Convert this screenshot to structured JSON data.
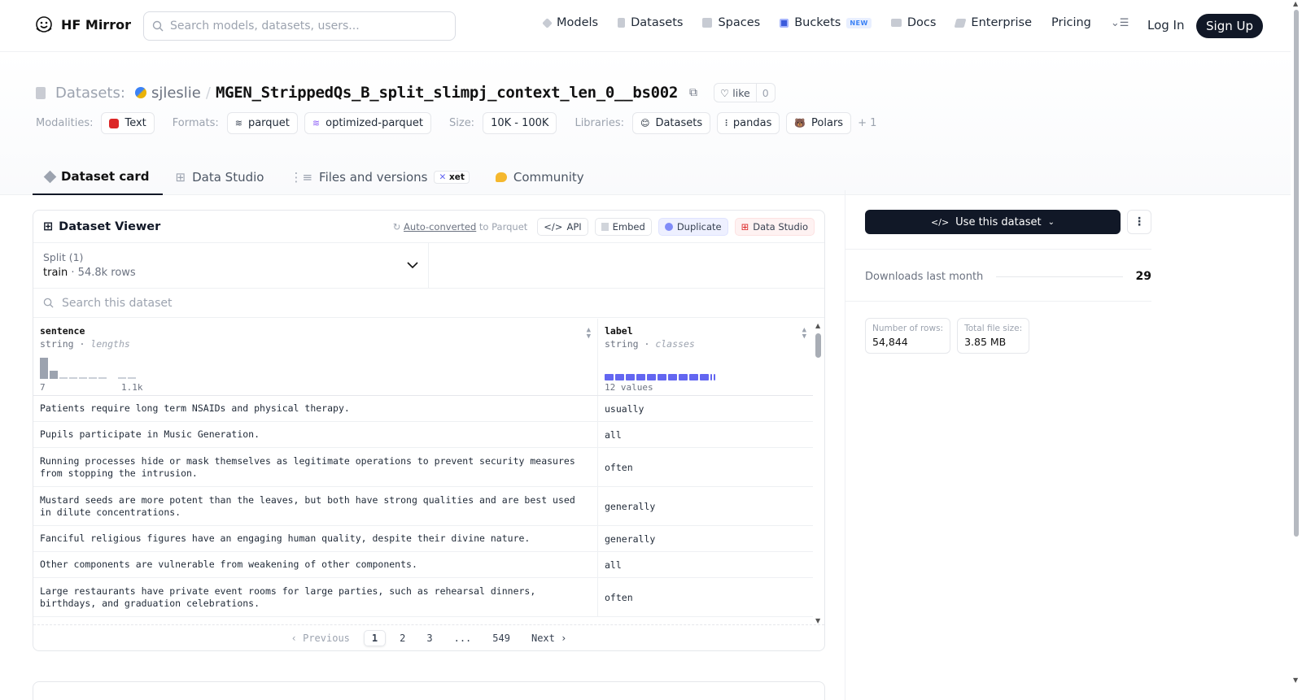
{
  "nav": {
    "brand": "HF Mirror",
    "search_placeholder": "Search models, datasets, users...",
    "links": [
      {
        "label": "Models",
        "icon": "models-icon"
      },
      {
        "label": "Datasets",
        "icon": "datasets-icon"
      },
      {
        "label": "Spaces",
        "icon": "spaces-icon"
      },
      {
        "label": "Buckets",
        "icon": "buckets-icon",
        "badge": "NEW"
      },
      {
        "label": "Docs",
        "icon": "docs-icon"
      },
      {
        "label": "Enterprise",
        "icon": "enterprise-icon"
      },
      {
        "label": "Pricing"
      }
    ],
    "login": "Log In",
    "signup": "Sign Up"
  },
  "header": {
    "section": "Datasets:",
    "owner": "sjleslie",
    "repo": "MGEN_StrippedQs_B_split_slimpj_context_len_0__bs002",
    "like_label": "like",
    "like_count": "0",
    "modalities_label": "Modalities:",
    "modality": "Text",
    "formats_label": "Formats:",
    "formats": [
      "parquet",
      "optimized-parquet"
    ],
    "size_label": "Size:",
    "size": "10K - 100K",
    "libraries_label": "Libraries:",
    "libraries": [
      "Datasets",
      "pandas",
      "Polars"
    ],
    "libraries_more": "+ 1"
  },
  "tabs": [
    {
      "label": "Dataset card",
      "active": true
    },
    {
      "label": "Data Studio"
    },
    {
      "label": "Files and versions",
      "badge": "xet"
    },
    {
      "label": "Community"
    }
  ],
  "viewer": {
    "title": "Dataset Viewer",
    "auto_converted": "Auto-converted",
    "auto_converted_suffix": "to Parquet",
    "actions": [
      "API",
      "Embed",
      "Duplicate",
      "Data Studio"
    ],
    "split_label": "Split (1)",
    "split_name": "train",
    "split_rows": "54.8k rows",
    "search_placeholder": "Search this dataset",
    "columns": [
      {
        "name": "sentence",
        "type": "string",
        "stat": "lengths",
        "min": "7",
        "max": "1.1k"
      },
      {
        "name": "label",
        "type": "string",
        "stat": "classes",
        "values": "12 values"
      }
    ],
    "rows": [
      {
        "sentence": "Patients require long term NSAIDs and physical therapy.",
        "label": "usually"
      },
      {
        "sentence": "Pupils participate in Music Generation.",
        "label": "all"
      },
      {
        "sentence": "Running processes hide or mask themselves as legitimate operations to prevent security measures from stopping the intrusion.",
        "label": "often"
      },
      {
        "sentence": "Mustard seeds are more potent than the leaves, but both have strong qualities and are best used in dilute concentrations.",
        "label": "generally"
      },
      {
        "sentence": "Fanciful religious figures have an engaging human quality, despite their divine nature.",
        "label": "generally"
      },
      {
        "sentence": "Other components are vulnerable from weakening of other components.",
        "label": "all"
      },
      {
        "sentence": "Large restaurants have private event rooms for large parties, such as rehearsal dinners, birthdays, and graduation celebrations.",
        "label": "often"
      }
    ],
    "pager": {
      "prev": "Previous",
      "pages": [
        "1",
        "2",
        "3",
        "...",
        "549"
      ],
      "next": "Next"
    }
  },
  "sidebar": {
    "use_button": "Use this dataset",
    "downloads_label": "Downloads last month",
    "downloads": "29",
    "rows_label": "Number of rows:",
    "rows_value": "54,844",
    "filesize_label": "Total file size:",
    "filesize_value": "3.85 MB"
  },
  "colors": {
    "accent": "#6366f1",
    "dark": "#111827"
  }
}
